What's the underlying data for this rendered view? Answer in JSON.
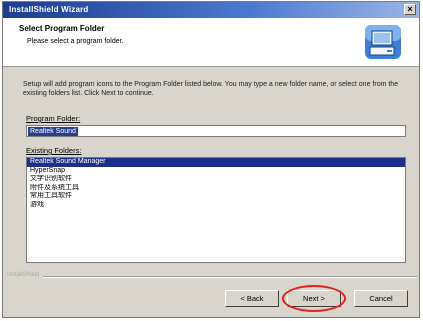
{
  "window": {
    "title": "InstallShield Wizard"
  },
  "header": {
    "title": "Select Program Folder",
    "subtitle": "Please select a program folder."
  },
  "instructions": "Setup will add program icons to the Program Folder listed below. You may type a new folder name, or select one from the existing folders list. Click Next to continue.",
  "program_folder": {
    "label": "Program Folder:",
    "value": "Realtek Sound"
  },
  "existing_folders": {
    "label": "Existing Folders:",
    "items": [
      {
        "label": "Realtek Sound Manager",
        "selected": true
      },
      {
        "label": "HyperSnap",
        "selected": false
      },
      {
        "label": "文字识别软件",
        "selected": false
      },
      {
        "label": "附件及系统工具",
        "selected": false
      },
      {
        "label": "常用工具软件",
        "selected": false
      },
      {
        "label": "游戏",
        "selected": false
      }
    ]
  },
  "footer": {
    "brand": "InstallShield"
  },
  "buttons": {
    "back": "< Back",
    "next": "Next >",
    "cancel": "Cancel"
  },
  "colors": {
    "title_bar": "#1b3d8f",
    "selection": "#1f2e88",
    "highlight_circle": "#e02020"
  }
}
